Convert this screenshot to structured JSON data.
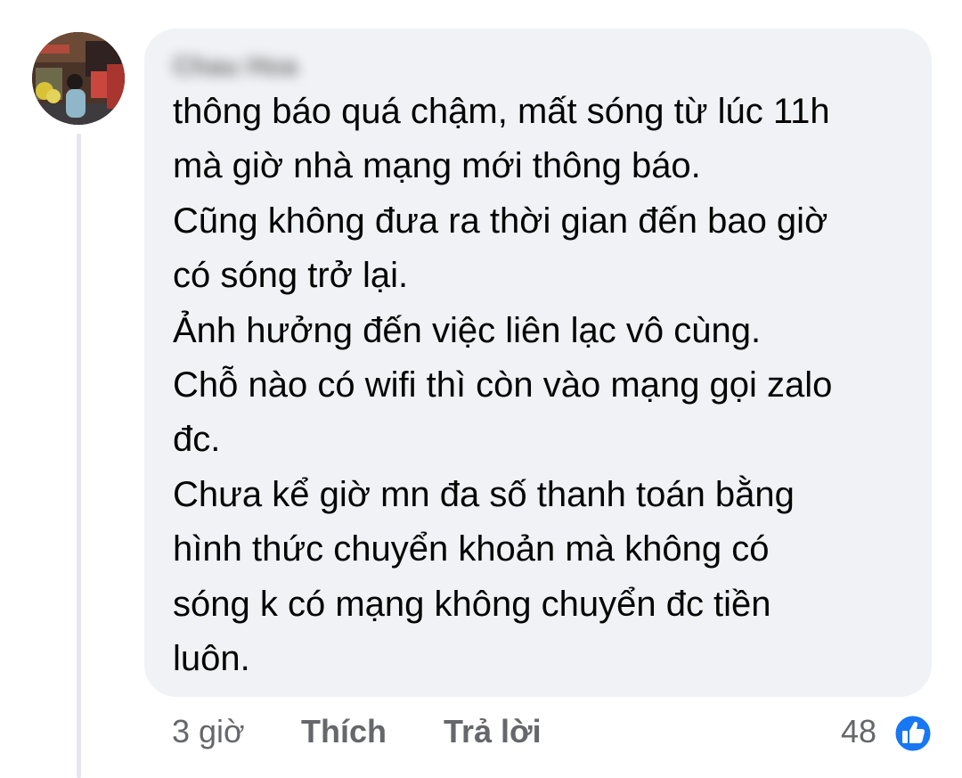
{
  "comment": {
    "author_name": "Chau Hoa",
    "body_lines": [
      "thông báo quá chậm, mất sóng từ lúc 11h",
      "mà giờ nhà mạng mới thông báo.",
      "Cũng không đưa ra thời gian đến bao giờ",
      "có sóng trở lại.",
      "Ảnh hưởng đến việc liên lạc vô cùng.",
      "Chỗ nào có wifi thì còn vào mạng gọi zalo",
      "đc.",
      "Chưa kể giờ mn đa số thanh toán bằng",
      "hình thức chuyển khoản mà không có",
      "sóng k có mạng không chuyển đc tiền",
      "luôn."
    ]
  },
  "actions": {
    "time": "3 giờ",
    "like_label": "Thích",
    "reply_label": "Trả lời"
  },
  "reactions": {
    "count": "48",
    "icon": "thumbs-up-icon",
    "badge_color": "#1877f2"
  },
  "colors": {
    "bubble": "#f0f2f5",
    "text": "#050505",
    "secondary_text": "#65676b",
    "thread_line": "#e4e6eb"
  }
}
